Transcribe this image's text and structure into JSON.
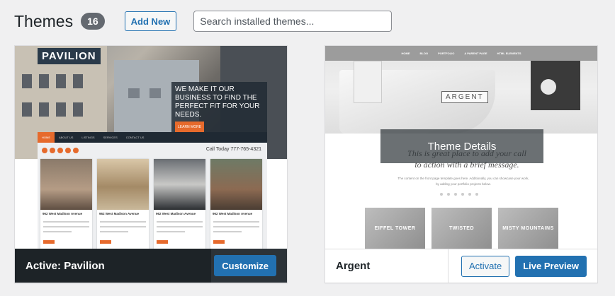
{
  "header": {
    "title": "Themes",
    "count": "16",
    "add_new": "Add New",
    "search_placeholder": "Search installed themes..."
  },
  "themes": [
    {
      "name": "Pavilion",
      "active_prefix": "Active:",
      "primary_action": "Customize",
      "screenshot": {
        "logo": "PAVILION",
        "tagline": "WE MAKE IT OUR BUSINESS TO FIND THE PERFECT FIT FOR YOUR NEEDS.",
        "tagline_button": "LEARN MORE",
        "nav": [
          "HOME",
          "ABOUT US",
          "LISTINGS",
          "SERVICES",
          "CONTACT US"
        ],
        "call": "Call Today  777-765-4321",
        "listings": [
          "962 West Madison Avenue",
          "962 West Madison Avenue",
          "962 West Madison Avenue",
          "962 West Madison Avenue"
        ]
      }
    },
    {
      "name": "Argent",
      "overlay": "Theme Details",
      "secondary_action": "Activate",
      "primary_action": "Live Preview",
      "screenshot": {
        "nav": [
          "HOME",
          "BLOG",
          "PORTFOLIO",
          "A PARENT PAGE",
          "HTML ELEMENTS"
        ],
        "logo": "ARGENT",
        "headline": "This is great place to add your call to action with a brief message.",
        "body": "The content on the front page template goes here. Additionally, you can showcase your work, by adding your portfolio projects below.",
        "tiles": [
          "EIFFEL TOWER",
          "TWISTED",
          "MISTY MOUNTAINS"
        ]
      }
    }
  ],
  "colors": {
    "accent": "#2271b1",
    "active_footer": "#1d2327",
    "badge": "#646970",
    "pavilion_orange": "#e66a2c"
  }
}
